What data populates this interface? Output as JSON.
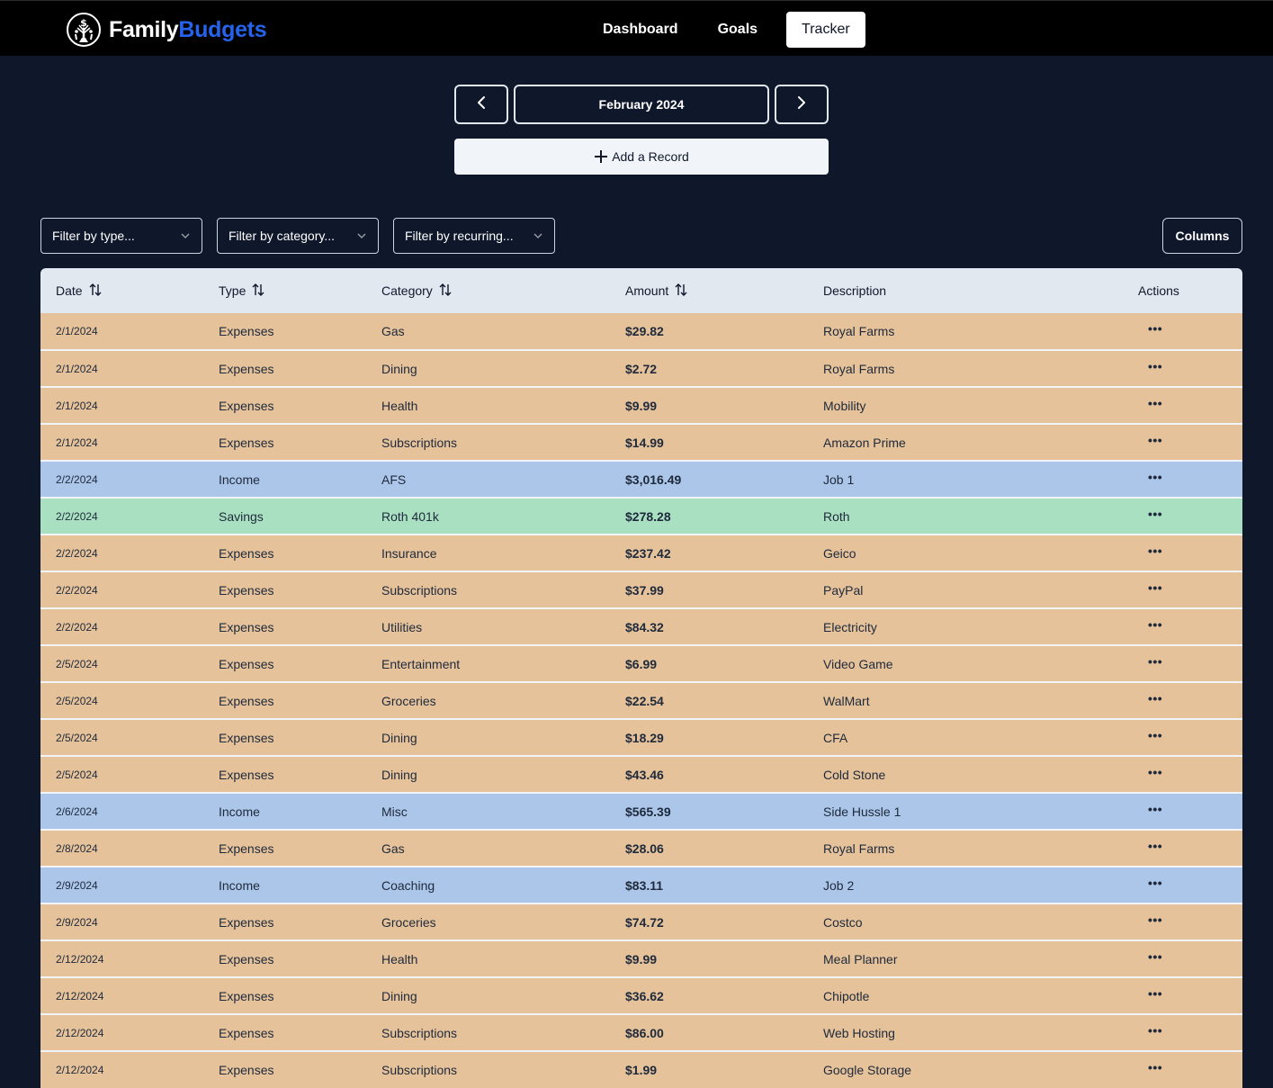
{
  "header": {
    "brand": {
      "part1": "Family",
      "part2": "Budgets",
      "logo_icon": "money-tree-icon"
    },
    "nav": [
      {
        "label": "Dashboard",
        "active": false
      },
      {
        "label": "Goals",
        "active": false
      },
      {
        "label": "Tracker",
        "active": true
      }
    ]
  },
  "month_selector": {
    "prev_icon": "chevron-left-icon",
    "label": "February 2024",
    "next_icon": "chevron-right-icon"
  },
  "add_record": {
    "label": "Add a Record",
    "icon": "plus-icon"
  },
  "filters": [
    {
      "placeholder": "Filter by type..."
    },
    {
      "placeholder": "Filter by category..."
    },
    {
      "placeholder": "Filter by recurring..."
    }
  ],
  "columns_button": {
    "label": "Columns"
  },
  "colors": {
    "background": "#0f172a",
    "header_bar": "#000000",
    "brand_accent": "#2563eb",
    "row_expenses": "#e5c29a",
    "row_income": "#abc6e9",
    "row_savings": "#aae0c2",
    "table_header": "#e2e8f0"
  },
  "table": {
    "columns": [
      {
        "label": "Date",
        "sortable": true
      },
      {
        "label": "Type",
        "sortable": true
      },
      {
        "label": "Category",
        "sortable": true
      },
      {
        "label": "Amount",
        "sortable": true
      },
      {
        "label": "Description",
        "sortable": false
      },
      {
        "label": "Actions",
        "sortable": false
      }
    ],
    "rows": [
      {
        "date": "2/1/2024",
        "type": "Expenses",
        "category": "Gas",
        "amount": "$29.82",
        "description": "Royal Farms"
      },
      {
        "date": "2/1/2024",
        "type": "Expenses",
        "category": "Dining",
        "amount": "$2.72",
        "description": "Royal Farms"
      },
      {
        "date": "2/1/2024",
        "type": "Expenses",
        "category": "Health",
        "amount": "$9.99",
        "description": "Mobility"
      },
      {
        "date": "2/1/2024",
        "type": "Expenses",
        "category": "Subscriptions",
        "amount": "$14.99",
        "description": "Amazon Prime"
      },
      {
        "date": "2/2/2024",
        "type": "Income",
        "category": "AFS",
        "amount": "$3,016.49",
        "description": "Job 1"
      },
      {
        "date": "2/2/2024",
        "type": "Savings",
        "category": "Roth 401k",
        "amount": "$278.28",
        "description": "Roth"
      },
      {
        "date": "2/2/2024",
        "type": "Expenses",
        "category": "Insurance",
        "amount": "$237.42",
        "description": "Geico"
      },
      {
        "date": "2/2/2024",
        "type": "Expenses",
        "category": "Subscriptions",
        "amount": "$37.99",
        "description": "PayPal"
      },
      {
        "date": "2/2/2024",
        "type": "Expenses",
        "category": "Utilities",
        "amount": "$84.32",
        "description": "Electricity"
      },
      {
        "date": "2/5/2024",
        "type": "Expenses",
        "category": "Entertainment",
        "amount": "$6.99",
        "description": "Video Game"
      },
      {
        "date": "2/5/2024",
        "type": "Expenses",
        "category": "Groceries",
        "amount": "$22.54",
        "description": "WalMart"
      },
      {
        "date": "2/5/2024",
        "type": "Expenses",
        "category": "Dining",
        "amount": "$18.29",
        "description": "CFA"
      },
      {
        "date": "2/5/2024",
        "type": "Expenses",
        "category": "Dining",
        "amount": "$43.46",
        "description": "Cold Stone"
      },
      {
        "date": "2/6/2024",
        "type": "Income",
        "category": "Misc",
        "amount": "$565.39",
        "description": "Side Hussle 1"
      },
      {
        "date": "2/8/2024",
        "type": "Expenses",
        "category": "Gas",
        "amount": "$28.06",
        "description": "Royal Farms"
      },
      {
        "date": "2/9/2024",
        "type": "Income",
        "category": "Coaching",
        "amount": "$83.11",
        "description": "Job 2"
      },
      {
        "date": "2/9/2024",
        "type": "Expenses",
        "category": "Groceries",
        "amount": "$74.72",
        "description": "Costco"
      },
      {
        "date": "2/12/2024",
        "type": "Expenses",
        "category": "Health",
        "amount": "$9.99",
        "description": "Meal Planner"
      },
      {
        "date": "2/12/2024",
        "type": "Expenses",
        "category": "Dining",
        "amount": "$36.62",
        "description": "Chipotle"
      },
      {
        "date": "2/12/2024",
        "type": "Expenses",
        "category": "Subscriptions",
        "amount": "$86.00",
        "description": "Web Hosting"
      },
      {
        "date": "2/12/2024",
        "type": "Expenses",
        "category": "Subscriptions",
        "amount": "$1.99",
        "description": "Google Storage"
      }
    ],
    "row_action_label": "•••",
    "sort_icon": "sort-arrows-icon"
  }
}
